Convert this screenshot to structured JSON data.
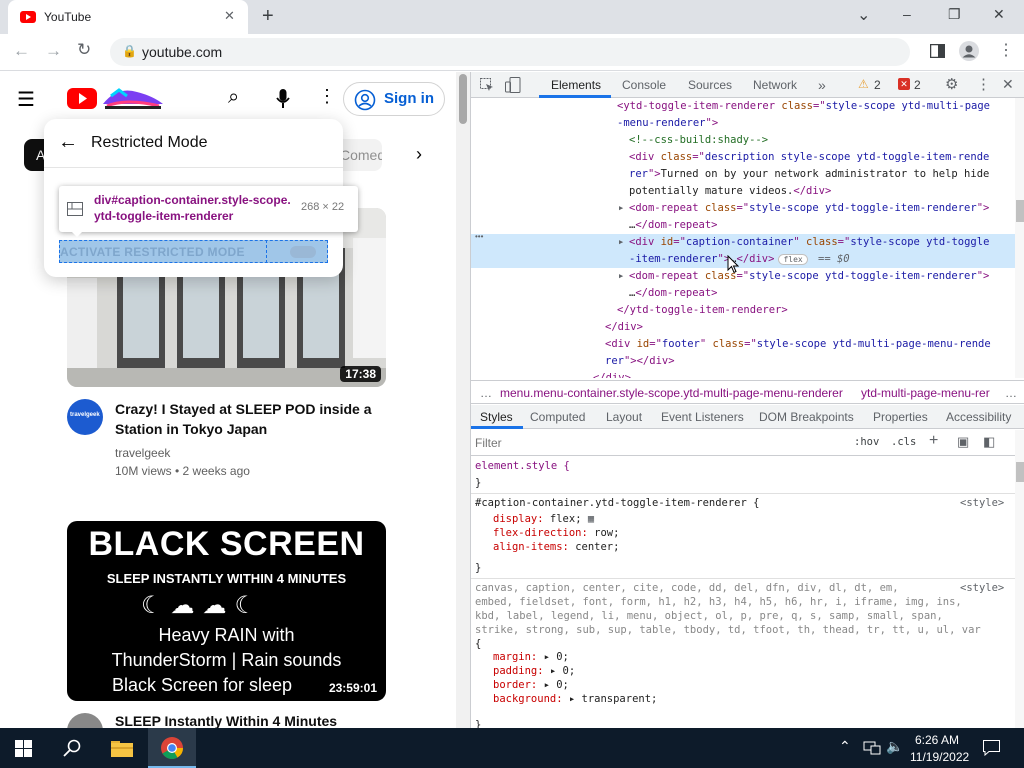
{
  "browser": {
    "tab_title": "YouTube",
    "url": "youtube.com",
    "new_tab": "+",
    "controls": {
      "minimize": "–",
      "restore": "❐",
      "close": "✕",
      "chevron": "⌄"
    }
  },
  "youtube": {
    "sign_in": "Sign in",
    "chip_a": "A",
    "chip_comedy": "Comed",
    "menu": {
      "title": "Restricted Mode",
      "activate": "ACTIVATE RESTRICTED MODE"
    },
    "tooltip": {
      "selector": "div#caption-container.style-scope.ytd-toggle-item-renderer",
      "size": "268 × 22"
    },
    "videos": [
      {
        "duration": "17:38",
        "title": "Crazy! I Stayed at SLEEP POD inside a Station in Tokyo Japan",
        "channel": "travelgeek",
        "meta": "10M views • 2 weeks ago",
        "avatar_text": "travelgeek"
      },
      {
        "duration": "23:59:01",
        "title": "SLEEP Instantly Within 4 Minutes",
        "thumb_lines": [
          "BLACK SCREEN",
          "SLEEP INSTANTLY WITHIN 4 MINUTES",
          "Heavy RAIN with",
          "ThunderStorm | Rain sounds",
          "Black Screen for sleep"
        ]
      }
    ]
  },
  "devtools": {
    "tabs": [
      "Elements",
      "Console",
      "Sources",
      "Network"
    ],
    "more": "»",
    "warn_count": "2",
    "err_count": "2",
    "code": [
      {
        "indent": 0,
        "parts": [
          [
            "tag",
            "<ytd-toggle-item-renderer "
          ],
          [
            "attr",
            "class"
          ],
          [
            "tag",
            "=\""
          ],
          [
            "val",
            "style-scope ytd-multi-page"
          ]
        ]
      },
      {
        "indent": 0,
        "parts": [
          [
            "val",
            "-menu-renderer"
          ],
          [
            "tag",
            "\">"
          ]
        ]
      },
      {
        "indent": 1,
        "parts": [
          [
            "cmt",
            "<!--css-build:shady-->"
          ]
        ]
      },
      {
        "indent": 1,
        "parts": [
          [
            "tag",
            "<div "
          ],
          [
            "attr",
            "class"
          ],
          [
            "tag",
            "=\""
          ],
          [
            "val",
            "description style-scope ytd-toggle-item-rende"
          ]
        ]
      },
      {
        "indent": 1,
        "parts": [
          [
            "val",
            "rer"
          ],
          [
            "tag",
            "\">"
          ],
          [
            "txt",
            "Turned on by your network administrator to help hide"
          ]
        ]
      },
      {
        "indent": 1,
        "parts": [
          [
            "txt",
            "potentially mature videos."
          ],
          [
            "tag",
            "</div>"
          ]
        ]
      },
      {
        "indent": 1,
        "arrow": true,
        "parts": [
          [
            "tag",
            "<dom-repeat "
          ],
          [
            "attr",
            "class"
          ],
          [
            "tag",
            "=\""
          ],
          [
            "val",
            "style-scope ytd-toggle-item-renderer"
          ],
          [
            "tag",
            "\">"
          ]
        ]
      },
      {
        "indent": 1,
        "parts": [
          [
            "txt",
            "…"
          ],
          [
            "tag",
            "</dom-repeat>"
          ]
        ]
      },
      {
        "indent": 1,
        "arrow": true,
        "hl": true,
        "parts": [
          [
            "tag",
            "<div "
          ],
          [
            "attr",
            "id"
          ],
          [
            "tag",
            "=\""
          ],
          [
            "val",
            "caption-container"
          ],
          [
            "tag",
            "\" "
          ],
          [
            "attr",
            "class"
          ],
          [
            "tag",
            "=\""
          ],
          [
            "val",
            "style-scope ytd-toggle"
          ]
        ]
      },
      {
        "indent": 1,
        "hl": true,
        "parts": [
          [
            "val",
            "-item-renderer"
          ],
          [
            "tag",
            "\">"
          ],
          [
            "txt",
            "…"
          ],
          [
            "tag",
            "</div>"
          ],
          [
            "badge",
            "flex"
          ],
          [
            "txt",
            " == $0"
          ]
        ]
      },
      {
        "indent": 1,
        "arrow": true,
        "parts": [
          [
            "tag",
            "<dom-repeat "
          ],
          [
            "attr",
            "class"
          ],
          [
            "tag",
            "=\""
          ],
          [
            "val",
            "style-scope ytd-toggle-item-renderer"
          ],
          [
            "tag",
            "\">"
          ]
        ]
      },
      {
        "indent": 1,
        "parts": [
          [
            "txt",
            "…"
          ],
          [
            "tag",
            "</dom-repeat>"
          ]
        ]
      },
      {
        "indent": 0,
        "parts": [
          [
            "tag",
            "</ytd-toggle-item-renderer>"
          ]
        ]
      },
      {
        "indent": -1,
        "parts": [
          [
            "tag",
            "</div>"
          ]
        ]
      },
      {
        "indent": -1,
        "parts": [
          [
            "tag",
            "<div "
          ],
          [
            "attr",
            "id"
          ],
          [
            "tag",
            "=\""
          ],
          [
            "val",
            "footer"
          ],
          [
            "tag",
            "\" "
          ],
          [
            "attr",
            "class"
          ],
          [
            "tag",
            "=\""
          ],
          [
            "val",
            "style-scope ytd-multi-page-menu-rende"
          ]
        ]
      },
      {
        "indent": -1,
        "parts": [
          [
            "val",
            "rer"
          ],
          [
            "tag",
            "\"></div>"
          ]
        ]
      },
      {
        "indent": -2,
        "parts": [
          [
            "tag",
            "</div>"
          ]
        ]
      }
    ],
    "breadcrumb": [
      "…",
      "menu.menu-container.style-scope.ytd-multi-page-menu-renderer",
      "ytd-multi-page-menu-rer",
      "…"
    ],
    "style_tabs": [
      "Styles",
      "Computed",
      "Layout",
      "Event Listeners",
      "DOM Breakpoints",
      "Properties",
      "Accessibility"
    ],
    "filter_placeholder": "Filter",
    "hov": ":hov",
    "cls": ".cls",
    "rules": {
      "element_style": "element.style {",
      "close": "}",
      "rule1_selector": "#caption-container.ytd-toggle-item-renderer {",
      "rule1_source": "<style>",
      "rule1_props": [
        [
          "display",
          "flex;"
        ],
        [
          "flex-direction",
          "row;"
        ],
        [
          "align-items",
          "center;"
        ]
      ],
      "rule2_source": "<style>",
      "rule2_selector_lines": [
        "canvas, caption, center, cite, code, dd, del, dfn, div, dl, dt, em,",
        "embed, fieldset, font, form, h1, h2, h3, h4, h5, h6, hr, i, iframe, img, ins,",
        "kbd, label, legend, li, menu, object, ol, p, pre, q, s, samp, small, span,",
        "strike, strong, sub, sup, table, tbody, td, tfoot, th, thead, tr, tt, u, ul, var",
        "{"
      ],
      "rule2_props": [
        [
          "margin",
          "▸ 0;"
        ],
        [
          "padding",
          "▸ 0;"
        ],
        [
          "border",
          "▸ 0;"
        ],
        [
          "background",
          "▸ transparent;"
        ]
      ]
    }
  },
  "taskbar": {
    "time": "6:26 AM",
    "date": "11/19/2022"
  },
  "colors": {
    "yt_red": "#ff0000",
    "link_blue": "#065fd4",
    "devtools_accent": "#1a73e8",
    "highlight_row": "#cfe8fc"
  }
}
